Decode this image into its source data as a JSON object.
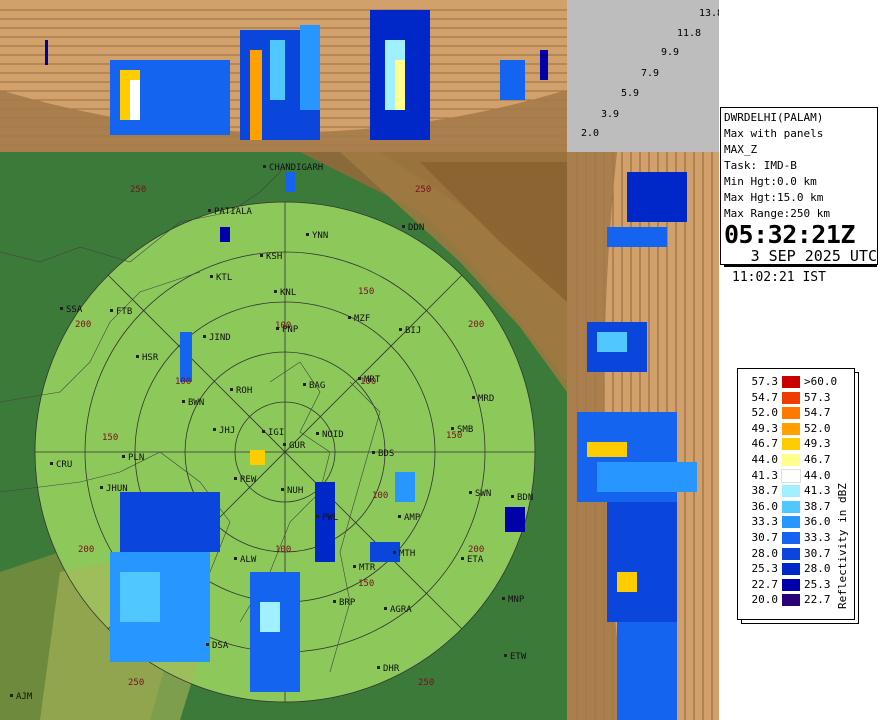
{
  "station": {
    "name": "DWRDELHI(PALAM)",
    "product": "Max with panels",
    "product_code": "MAX_Z",
    "task": "Task: IMD-B",
    "min_height": "Min Hgt:0.0 km",
    "max_height": "Max Hgt:15.0 km",
    "max_range": "Max Range:250 km"
  },
  "time": {
    "utc_time": "05:32:21Z",
    "utc_date": "3 SEP 2025 UTC",
    "ist": "11:02:21 IST"
  },
  "height_scale": [
    "13.8",
    "11.8",
    "9.9",
    "7.9",
    "5.9",
    "3.9",
    "2.0"
  ],
  "range_labels": [
    "100",
    "150",
    "200",
    "250"
  ],
  "legend": {
    "title": "Reflectivity in dBZ",
    "rows": [
      {
        "lo": "57.3",
        "hi": ">60.0",
        "color": "#c80000"
      },
      {
        "lo": "54.7",
        "hi": "57.3",
        "color": "#f03c00"
      },
      {
        "lo": "52.0",
        "hi": "54.7",
        "color": "#ff7800"
      },
      {
        "lo": "49.3",
        "hi": "52.0",
        "color": "#ffa000"
      },
      {
        "lo": "46.7",
        "hi": "49.3",
        "color": "#ffcc00"
      },
      {
        "lo": "44.0",
        "hi": "46.7",
        "color": "#ffff8c"
      },
      {
        "lo": "41.3",
        "hi": "44.0",
        "color": "#ffffff"
      },
      {
        "lo": "38.7",
        "hi": "41.3",
        "color": "#a0f0ff"
      },
      {
        "lo": "36.0",
        "hi": "38.7",
        "color": "#50c8ff"
      },
      {
        "lo": "33.3",
        "hi": "36.0",
        "color": "#2896ff"
      },
      {
        "lo": "30.7",
        "hi": "33.3",
        "color": "#1464f0"
      },
      {
        "lo": "28.0",
        "hi": "30.7",
        "color": "#0a46dc"
      },
      {
        "lo": "25.3",
        "hi": "28.0",
        "color": "#0028c8"
      },
      {
        "lo": "22.7",
        "hi": "25.3",
        "color": "#0000aa"
      },
      {
        "lo": "20.0",
        "hi": "22.7",
        "color": "#280078"
      }
    ]
  },
  "places": [
    {
      "code": "CHANDIGARH"
    },
    {
      "code": "PATIALA"
    },
    {
      "code": "YNN"
    },
    {
      "code": "DDN"
    },
    {
      "code": "KSH"
    },
    {
      "code": "KTL"
    },
    {
      "code": "KNL"
    },
    {
      "code": "SSA"
    },
    {
      "code": "FTB"
    },
    {
      "code": "MZF"
    },
    {
      "code": "BIJ"
    },
    {
      "code": "JIND"
    },
    {
      "code": "PNP"
    },
    {
      "code": "HSR"
    },
    {
      "code": "BAG"
    },
    {
      "code": "MRT"
    },
    {
      "code": "ROH"
    },
    {
      "code": "BWN"
    },
    {
      "code": "MRD"
    },
    {
      "code": "JHJ"
    },
    {
      "code": "IGI"
    },
    {
      "code": "NOID"
    },
    {
      "code": "GUR"
    },
    {
      "code": "SMB"
    },
    {
      "code": "CRU"
    },
    {
      "code": "PLN"
    },
    {
      "code": "BDS"
    },
    {
      "code": "JHUN"
    },
    {
      "code": "REW"
    },
    {
      "code": "NUH"
    },
    {
      "code": "SWN"
    },
    {
      "code": "BDN"
    },
    {
      "code": "AMP"
    },
    {
      "code": "PWL"
    },
    {
      "code": "MTH"
    },
    {
      "code": "ALW"
    },
    {
      "code": "ETA"
    },
    {
      "code": "MTR"
    },
    {
      "code": "BRP"
    },
    {
      "code": "AGRA"
    },
    {
      "code": "MNP"
    },
    {
      "code": "DSA"
    },
    {
      "code": "ETW"
    },
    {
      "code": "DHR"
    },
    {
      "code": "AJM"
    }
  ]
}
